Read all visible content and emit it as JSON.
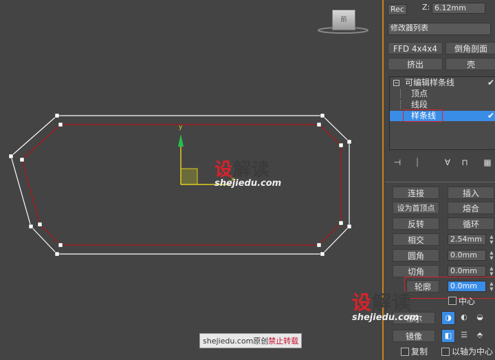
{
  "viewport": {
    "nav_cube_label": "前",
    "axis_y": "y",
    "axis_x": "x",
    "watermark_cn": [
      "设",
      "解读"
    ],
    "watermark_url": "shejiedu.com",
    "footer_prefix": "shejiedu.com原创",
    "footer_warning": "禁止转载"
  },
  "panel": {
    "top_field_fragment": "Rec",
    "z_label": "Z:",
    "z_value": "6.12mm",
    "modifier_list": "修改器列表",
    "buttons_row1": [
      "FFD 4x4x4",
      "倒角剖面"
    ],
    "buttons_row2": [
      "挤出",
      "壳"
    ],
    "stack": {
      "root": "可编辑样条线",
      "children": [
        "顶点",
        "线段",
        "样条线"
      ],
      "selected": "样条线"
    },
    "geometry": {
      "connect": "连接",
      "insert": "插入",
      "make_first": "设为首顶点",
      "fuse": "熔合",
      "reverse": "反转",
      "cycle": "循环",
      "crossinsert": "相交",
      "crossinsert_value": "2.54mm",
      "fillet": "圆角",
      "fillet_value": "0.0mm",
      "chamfer": "切角",
      "chamfer_value": "0.0mm",
      "outline": "轮廓",
      "outline_value": "0.0mm",
      "center": "中心",
      "boolean": "布尔",
      "mirror": "镜像",
      "copy": "复制",
      "about_pivot": "以轴为中心"
    },
    "watermark_cn": [
      "设",
      "解读"
    ],
    "watermark_url": "shejiedu.com"
  },
  "colors": {
    "outer_spline": "#ffffff",
    "inner_spline": "#b01414",
    "selection": "#3a8de6",
    "highlight_box": "#d9222a",
    "gizmo_y": "#22c24a",
    "gizmo_x": "#e0d020"
  }
}
